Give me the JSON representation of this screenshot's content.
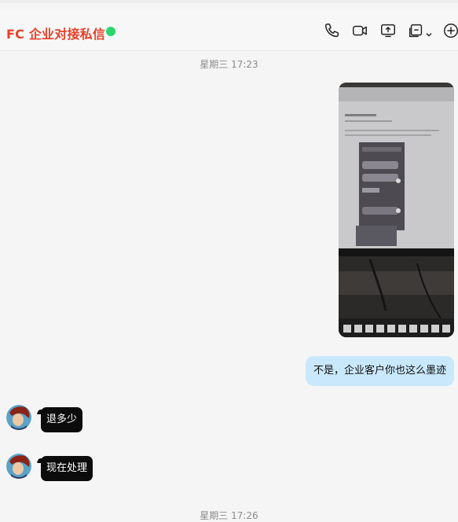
{
  "header": {
    "title": "FC 企业对接私信",
    "online_color": "#2cd66d",
    "tools": [
      "phone-icon",
      "video-call-icon",
      "screen-share-icon",
      "screen-record-icon",
      "add-circle-icon"
    ]
  },
  "messages": [
    {
      "type": "timestamp",
      "text": "星期三 17:23"
    },
    {
      "type": "image",
      "from": "me"
    },
    {
      "type": "text",
      "from": "me",
      "text": "不是，企业客户你也这么墨迹"
    },
    {
      "type": "text",
      "from": "them",
      "text": "退多少"
    },
    {
      "type": "text",
      "from": "them",
      "text": "现在处理"
    },
    {
      "type": "timestamp",
      "text": "星期三 17:26"
    }
  ],
  "colors": {
    "title": "#e8412b",
    "my_bubble": "#c9e8fc",
    "their_bubble": "#0c0c0c"
  }
}
